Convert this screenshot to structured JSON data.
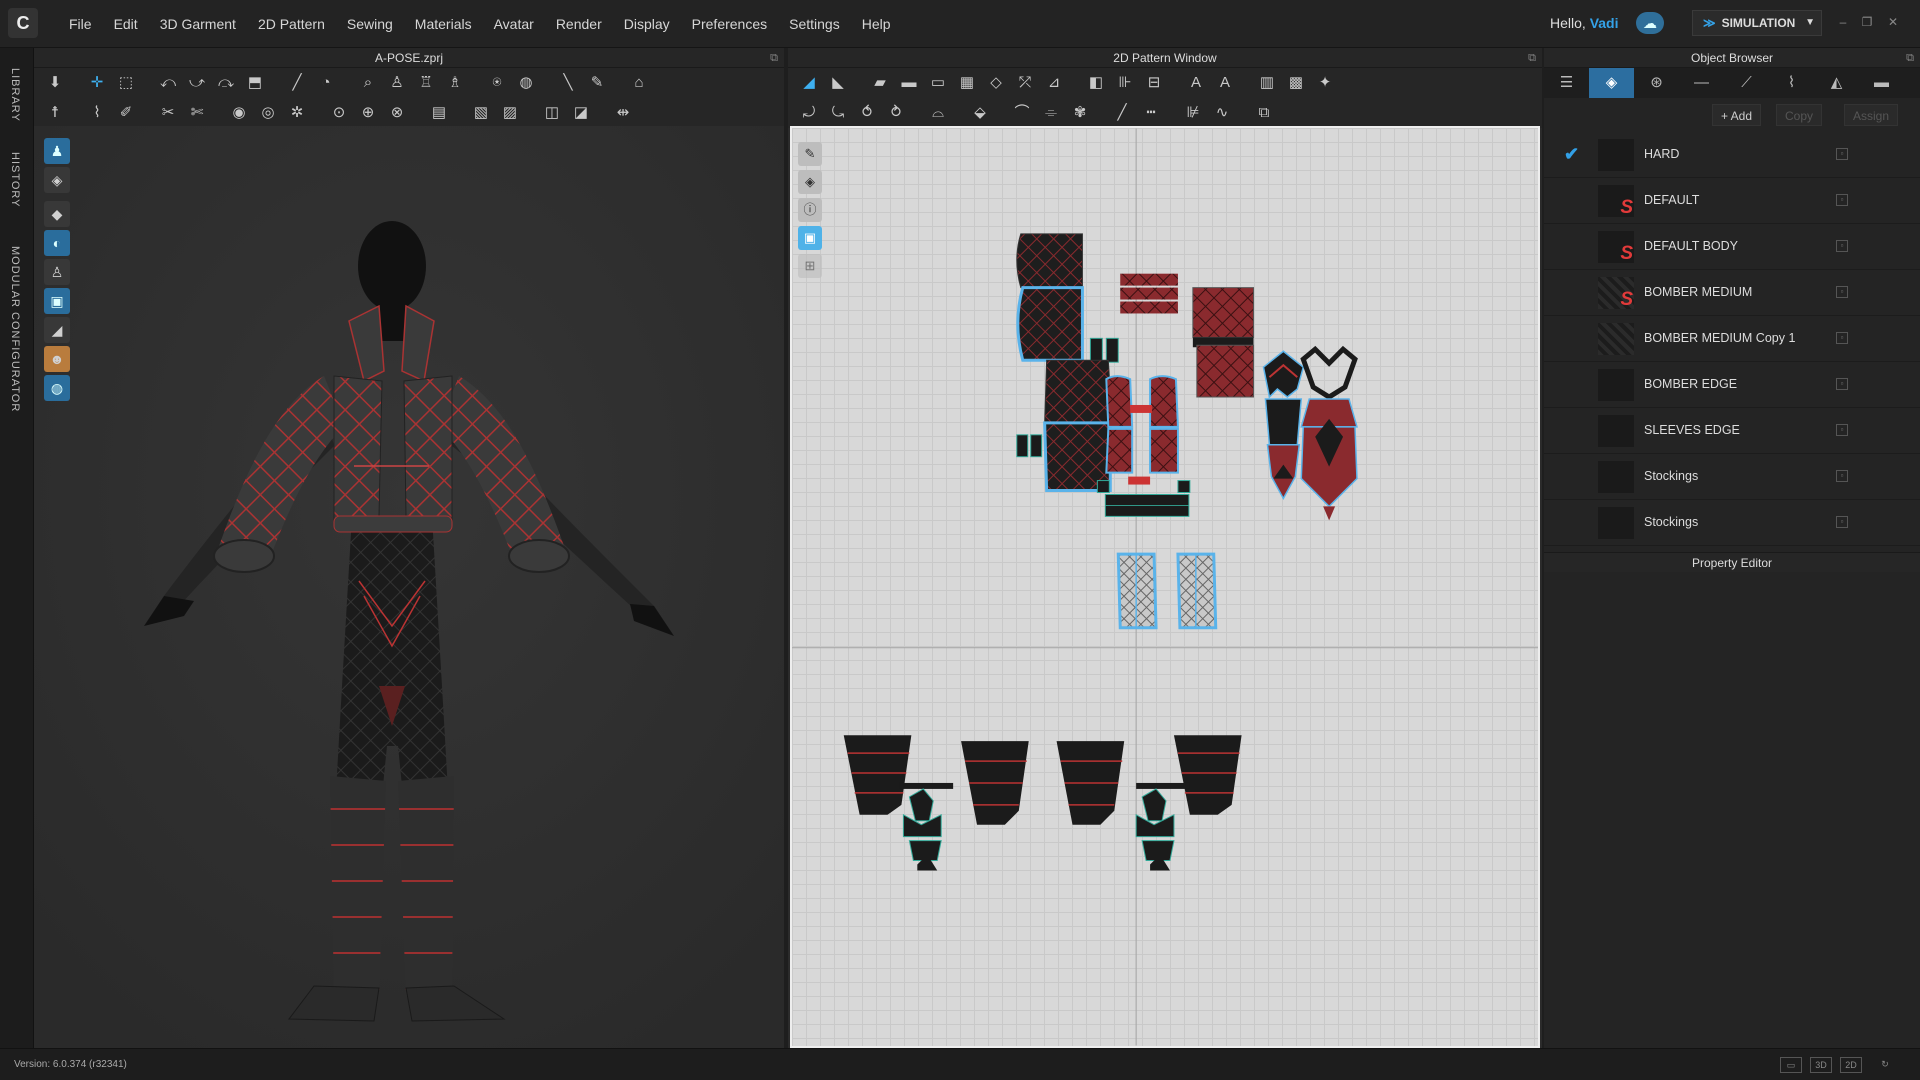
{
  "app": {
    "logo": "C",
    "menus": [
      "File",
      "Edit",
      "3D Garment",
      "2D Pattern",
      "Sewing",
      "Materials",
      "Avatar",
      "Render",
      "Display",
      "Preferences",
      "Settings",
      "Help"
    ],
    "greeting": "Hello,",
    "user": "Vadi",
    "mode": "SIMULATION"
  },
  "sidetabs": [
    "LIBRARY",
    "HISTORY",
    "MODULAR CONFIGURATOR"
  ],
  "panel3d": {
    "title": "A-POSE.zprj"
  },
  "panel2d": {
    "title": "2D Pattern Window"
  },
  "object_browser": {
    "title": "Object Browser",
    "add_label": "+ Add",
    "copy_label": "Copy",
    "assign_label": "Assign",
    "items": [
      {
        "name": "HARD",
        "checked": true,
        "thumb": "dark"
      },
      {
        "name": "DEFAULT",
        "checked": false,
        "thumb": "s"
      },
      {
        "name": "DEFAULT BODY",
        "checked": false,
        "thumb": "s"
      },
      {
        "name": "BOMBER MEDIUM",
        "checked": false,
        "thumb": "s-tex"
      },
      {
        "name": "BOMBER MEDIUM Copy 1",
        "checked": false,
        "thumb": "tex"
      },
      {
        "name": "BOMBER EDGE",
        "checked": false,
        "thumb": "dark"
      },
      {
        "name": "SLEEVES EDGE",
        "checked": false,
        "thumb": "dark"
      },
      {
        "name": "Stockings",
        "checked": false,
        "thumb": "dark"
      },
      {
        "name": "Stockings",
        "checked": false,
        "thumb": "dark"
      }
    ]
  },
  "property_editor": {
    "title": "Property Editor"
  },
  "status": {
    "version": "Version: 6.0.374 (r32341)"
  },
  "colors": {
    "accent": "#34a2e8",
    "pattern_red": "#8a2a2e",
    "pattern_dark": "#1b1b1b",
    "outline_blue": "#5ab3ea"
  }
}
